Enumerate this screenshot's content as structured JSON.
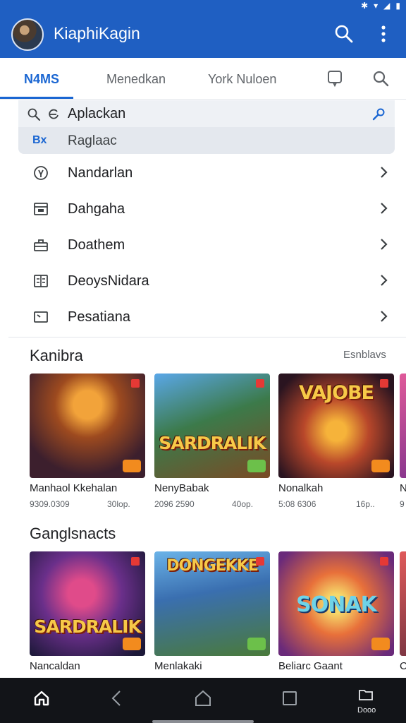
{
  "app": {
    "title": "KiaphiKagin"
  },
  "tabs": [
    {
      "label": "N4MS"
    },
    {
      "label": "Menedkan"
    },
    {
      "label": "York  Nuloen"
    }
  ],
  "search": {
    "query": "Aplackan",
    "suggestion_tag": "Bx",
    "suggestion": "Raglaac"
  },
  "menu": [
    {
      "label": "Nandarlan",
      "icon": "location-pin-icon"
    },
    {
      "label": "Dahgaha",
      "icon": "calendar-icon"
    },
    {
      "label": "Doathem",
      "icon": "briefcase-icon"
    },
    {
      "label": "DeoysNidara",
      "icon": "document-icon"
    },
    {
      "label": "Pesatiana",
      "icon": "screen-icon"
    }
  ],
  "sections": [
    {
      "title": "Kanibra",
      "see_all": "Esnblavs",
      "cards": [
        {
          "name": "Manhaol Kkehalan",
          "meta": "9309.0309",
          "size": "30lop.",
          "logo": ""
        },
        {
          "name": "NenyBabak",
          "meta": "2096 2590",
          "size": "40op.",
          "logo": "SARDRALIK"
        },
        {
          "name": "Nonalkah",
          "meta": "5:08 6306",
          "size": "16p..",
          "logo": "VAJOBE"
        },
        {
          "name": "N",
          "meta": "9",
          "size": "",
          "logo": ""
        }
      ]
    },
    {
      "title": "Ganglsnacts",
      "see_all": "",
      "cards": [
        {
          "name": "Nancaldan",
          "meta": "",
          "size": "",
          "logo": "SARDRALIK"
        },
        {
          "name": "Menlakaki",
          "meta": "",
          "size": "",
          "logo": "DONGEKKE"
        },
        {
          "name": "Beliarc Gaant",
          "meta": "",
          "size": "",
          "logo": "SONAK"
        },
        {
          "name": "C",
          "meta": "",
          "size": "",
          "logo": ""
        }
      ]
    }
  ],
  "navbar": {
    "recents_label": "Dooo"
  },
  "colors": {
    "primary": "#1f5fc2",
    "accent": "#1a66d2",
    "nav_bg": "#121418"
  }
}
